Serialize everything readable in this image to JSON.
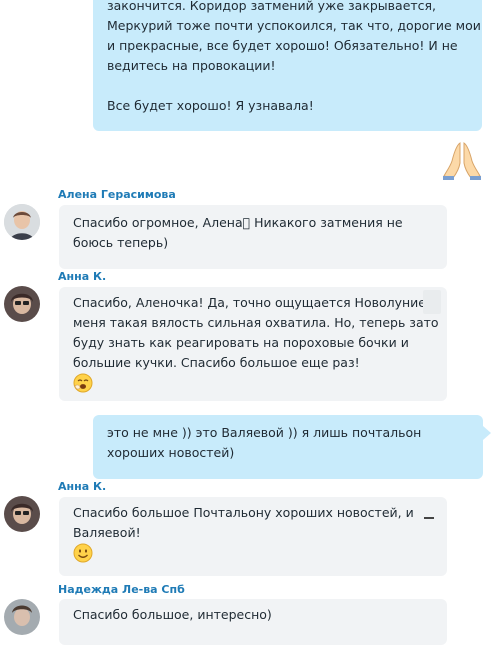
{
  "messages": [
    {
      "id": "out1",
      "lines": [
        "закончится. Коридор затмений уже закрывается,",
        "Меркурий тоже почти успокоился, так что, дорогие мои",
        "и прекрасные, все будет хорошо! Обязательно! И не",
        "ведитесь на провокации!",
        "",
        "Все будет хорошо! Я узнавала!"
      ]
    },
    {
      "id": "in1",
      "sender": "Алена Герасимова",
      "lines": [
        "Спасибо огромное, Алена􏿾 Никакого затмения не",
        "боюсь теперь)"
      ]
    },
    {
      "id": "in2",
      "sender": "Анна К.",
      "lines": [
        "Спасибо, Аленочка! Да, точно ощущается Новолуние,",
        "меня такая вялость сильная охватила. Но, теперь зато",
        "буду знать как реагировать на пороховые бочки и",
        "большие кучки. Спасибо большое еще раз!"
      ],
      "emoji": "yawning-face"
    },
    {
      "id": "out2",
      "lines": [
        "это не мне )) это Валяевой )) я лишь почтальон",
        "хороших новостей)"
      ]
    },
    {
      "id": "in3",
      "sender": "Анна К.",
      "lines": [
        "Спасибо большое Почтальону хороших новостей, и",
        "Валяевой!"
      ],
      "emoji": "smiling-face"
    },
    {
      "id": "in4",
      "sender": "Надежда Ле-ва Спб",
      "lines": [
        "Спасибо большое, интересно)"
      ]
    }
  ],
  "reaction": "folded-hands-emoji",
  "colors": {
    "outgoing_bubble": "#c8ebfb",
    "incoming_bubble": "#f1f3f5",
    "sender_name": "#1f7bb6"
  }
}
